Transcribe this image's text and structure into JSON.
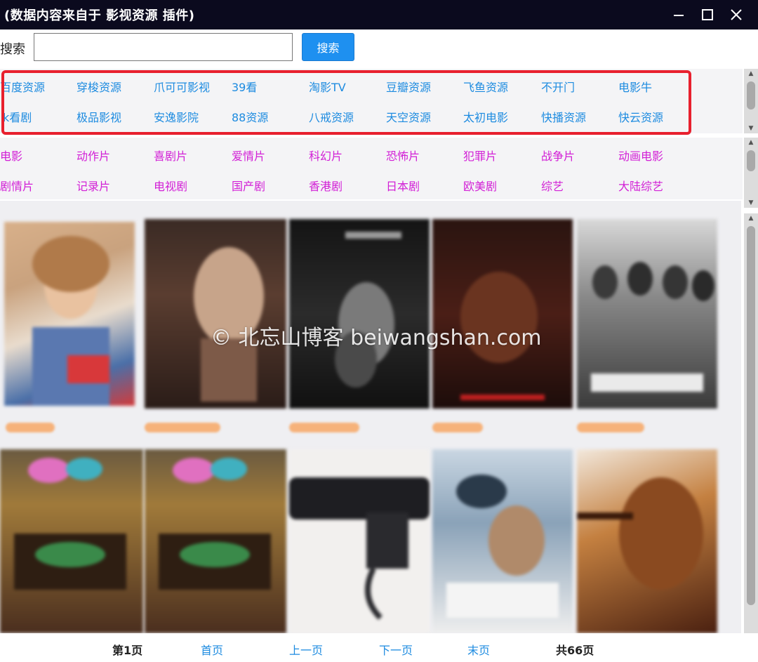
{
  "window": {
    "title": "(数据内容来自于 影视资源 插件)",
    "controls": [
      "minimize-icon",
      "maximize-icon",
      "close-icon"
    ]
  },
  "search": {
    "label": "搜索",
    "value": "",
    "placeholder": "",
    "button_label": "搜索"
  },
  "sources": [
    [
      "百度资源",
      "穿梭资源",
      "爪可可影视",
      "39看",
      "淘影TV",
      "豆瓣资源",
      "飞鱼资源",
      "不开门",
      "电影牛"
    ],
    [
      "k看剧",
      "极品影视",
      "安逸影院",
      "88资源",
      "八戒资源",
      "天空资源",
      "太初电影",
      "快播资源",
      "快云资源"
    ]
  ],
  "categories": [
    [
      "电影",
      "动作片",
      "喜剧片",
      "爱情片",
      "科幻片",
      "恐怖片",
      "犯罪片",
      "战争片",
      "动画电影"
    ],
    [
      "剧情片",
      "记录片",
      "电视剧",
      "国产剧",
      "香港剧",
      "日本剧",
      "欧美剧",
      "综艺",
      "大陆综艺"
    ]
  ],
  "watermark": "© 北忘山博客 beiwangshan.com",
  "pager": {
    "current": "第1页",
    "first": "首页",
    "prev": "上一页",
    "next": "下一页",
    "last": "末页",
    "total": "共66页"
  },
  "colors": {
    "titlebar": "#0b0a1e",
    "source_link": "#1d8be0",
    "category_link": "#d21fd6",
    "highlight_border": "#e8202e",
    "search_button": "#1e90f0",
    "poster_title": "#f6b27a"
  }
}
